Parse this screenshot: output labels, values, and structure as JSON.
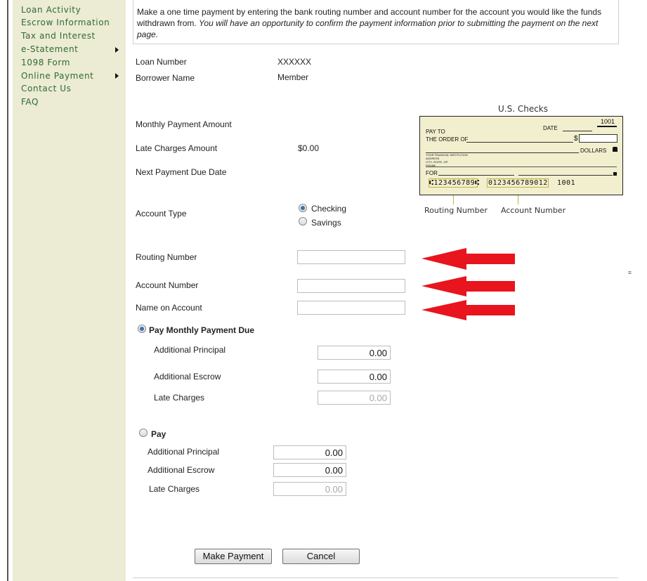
{
  "sidebar": {
    "items": [
      {
        "label": "Loan Activity",
        "has_submenu": false
      },
      {
        "label": "Escrow Information",
        "has_submenu": false
      },
      {
        "label": "Tax and Interest",
        "has_submenu": false
      },
      {
        "label": "e-Statement",
        "has_submenu": true
      },
      {
        "label": "1098 Form",
        "has_submenu": false
      },
      {
        "label": "Online Payment",
        "has_submenu": true
      },
      {
        "label": "Contact Us",
        "has_submenu": false
      },
      {
        "label": "FAQ",
        "has_submenu": false
      }
    ]
  },
  "intro": {
    "text": "Make a one time payment by entering the bank routing number and account number for the account you would like the funds withdrawn from.",
    "italic": "You will have an opportunity to confirm the payment information prior to submitting the payment on the next page."
  },
  "loan": {
    "loan_number_label": "Loan Number",
    "loan_number_value": "XXXXXX",
    "borrower_label": "Borrower Name",
    "borrower_value": "Member",
    "monthly_payment_label": "Monthly Payment Amount",
    "monthly_payment_value": "",
    "late_charges_label": "Late Charges Amount",
    "late_charges_value": "$0.00",
    "next_due_label": "Next Payment Due Date",
    "next_due_value": ""
  },
  "check_image": {
    "caption": "U.S. Checks",
    "number": "1001",
    "date": "DATE",
    "pay_to": "PAY TO",
    "the_order_of": "THE ORDER OF",
    "dollar_sign": "$",
    "dollars": "DOLLARS",
    "institution": "YOUR FINANCIAL INSTITUTION",
    "address": "ADDRESS",
    "city": "CITY, STATE, ZIP",
    "phone": "PHONE",
    "for": "FOR",
    "micr_routing": "⑆123456789⑆",
    "micr_account": "0123456789012",
    "micr_check": "1001",
    "routing_caption": "Routing Number",
    "account_caption": "Account Number"
  },
  "account_type": {
    "label": "Account Type",
    "options": [
      "Checking",
      "Savings"
    ],
    "selected": "Checking"
  },
  "bank_fields": {
    "routing_label": "Routing Number",
    "routing_value": "",
    "account_label": "Account Number",
    "account_value": "",
    "name_label": "Name on Account",
    "name_value": ""
  },
  "annotation_color": "#e8141e",
  "option_monthly": {
    "label": "Pay Monthly Payment Due",
    "selected": true,
    "additional_principal_label": "Additional Principal",
    "additional_principal_value": "0.00",
    "additional_escrow_label": "Additional Escrow",
    "additional_escrow_value": "0.00",
    "late_charges_label": "Late Charges",
    "late_charges_value": "0.00"
  },
  "option_pay": {
    "label": "Pay",
    "selected": false,
    "additional_principal_label": "Additional Principal",
    "additional_principal_value": "0.00",
    "additional_escrow_label": "Additional Escrow",
    "additional_escrow_value": "0.00",
    "late_charges_label": "Late Charges",
    "late_charges_value": "0.00"
  },
  "buttons": {
    "submit": "Make Payment",
    "cancel": "Cancel"
  },
  "colors": {
    "sidebar_bg": "#ecebd4",
    "nav_text": "#2f6b32",
    "check_bg": "#f2efcf"
  }
}
